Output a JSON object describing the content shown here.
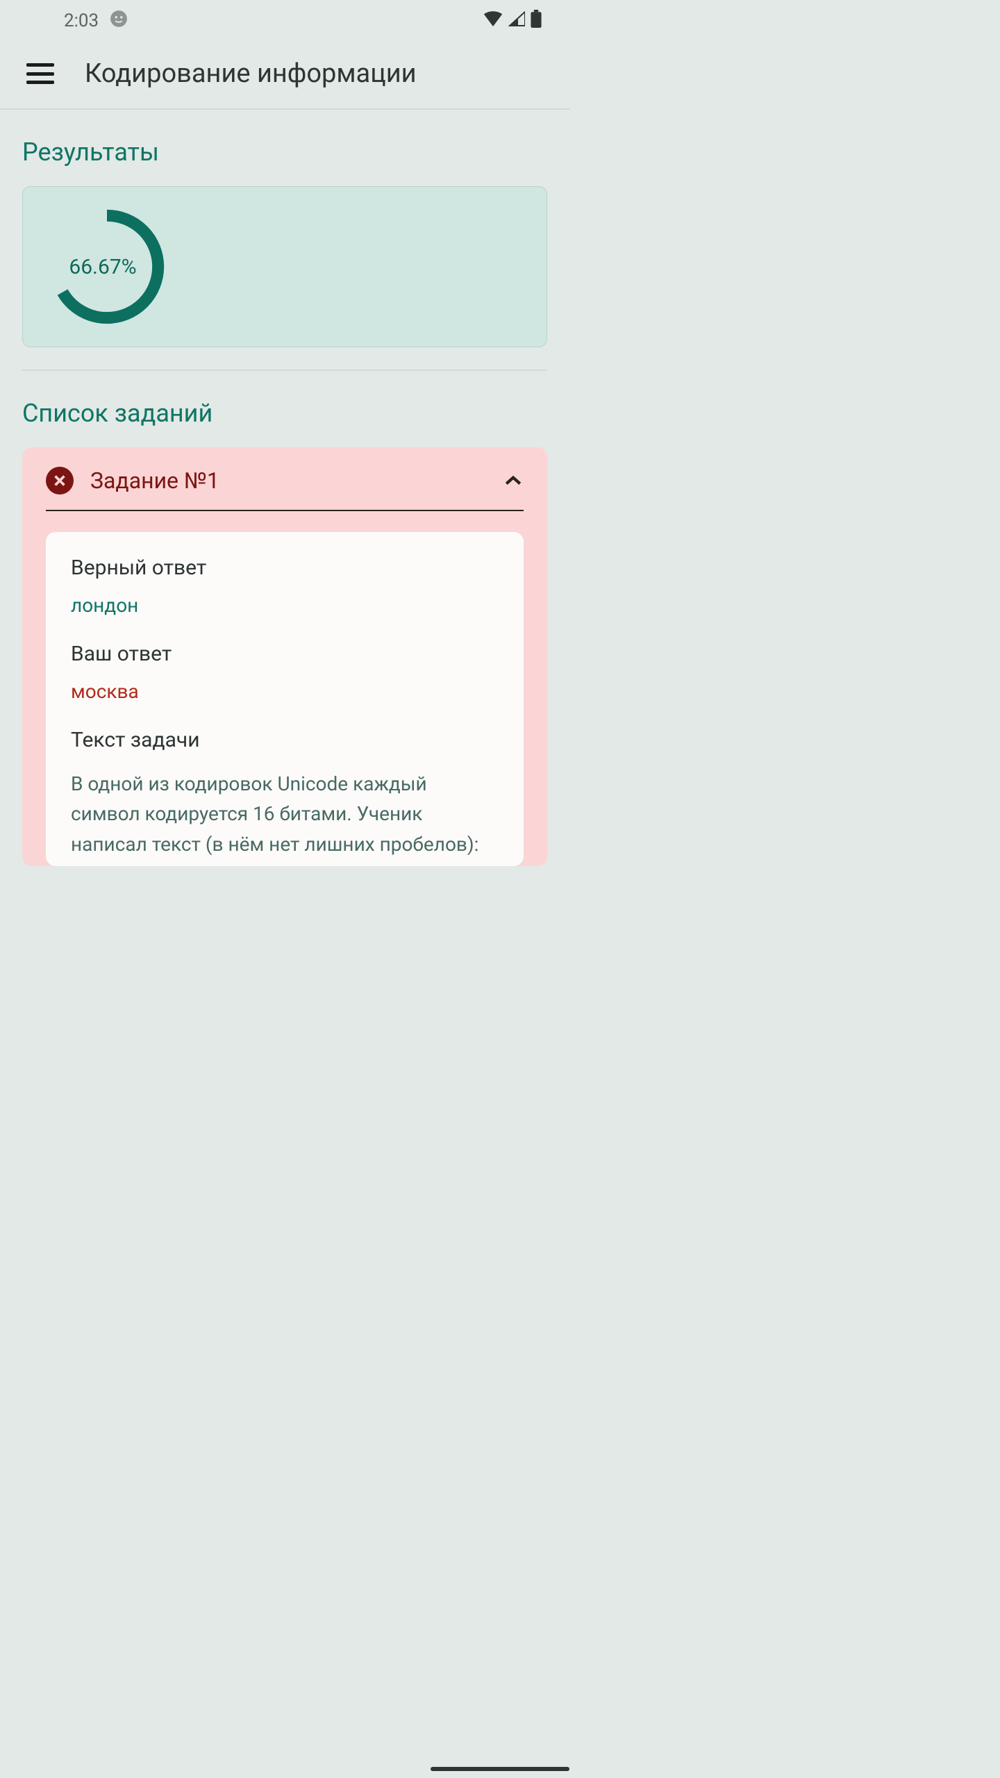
{
  "status": {
    "time": "2:03"
  },
  "appbar": {
    "title": "Кодирование информации"
  },
  "sections": {
    "results_title": "Результаты",
    "tasks_title": "Список заданий"
  },
  "chart_data": {
    "type": "pie",
    "title": "",
    "value_percent": 66.67,
    "value_label": "66.67%",
    "remaining_percent": 33.33
  },
  "task": {
    "title": "Задание №1",
    "correct_label": "Верный ответ",
    "correct_value": "лондон",
    "user_label": "Ваш ответ",
    "user_value": "москва",
    "text_label": "Текст задачи",
    "text_body": "В одной из кодировок Unicode каждый символ кодируется 16 битами. Ученик написал текст (в нём нет лишних пробелов):",
    "status": "incorrect",
    "expanded": true
  }
}
